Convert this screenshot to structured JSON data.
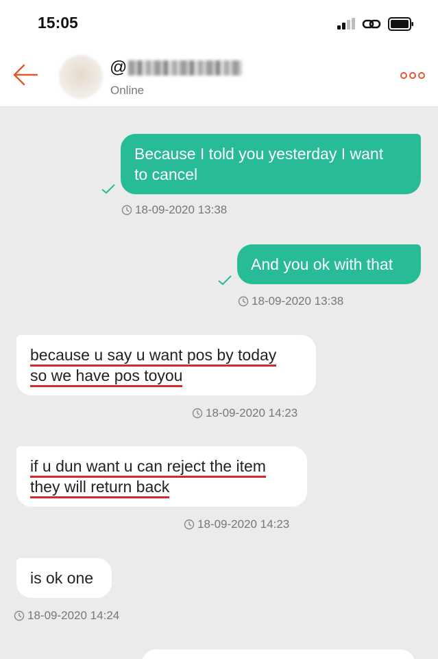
{
  "status_bar": {
    "time": "15:05"
  },
  "header": {
    "handle_prefix": "@",
    "status": "Online"
  },
  "colors": {
    "accent": "#e4572e",
    "sent_bubble": "#27bb98",
    "underline": "#d22a2a"
  },
  "messages": [
    {
      "direction": "sent",
      "lines": [
        "Because I told you yesterday I want",
        "to cancel"
      ],
      "timestamp": "18-09-2020 13:38",
      "read": true
    },
    {
      "direction": "sent",
      "lines": [
        "And you ok with that"
      ],
      "timestamp": "18-09-2020 13:38",
      "read": true
    },
    {
      "direction": "received",
      "lines": [
        "because u say u want pos by today",
        "so we have pos toyou"
      ],
      "timestamp": "18-09-2020 14:23",
      "underlined": true
    },
    {
      "direction": "received",
      "lines": [
        "if u dun want u can reject the item",
        "they will return back"
      ],
      "timestamp": "18-09-2020 14:23",
      "underlined": true
    },
    {
      "direction": "received",
      "lines": [
        "is ok one"
      ],
      "timestamp": "18-09-2020 14:24",
      "underlined": false
    }
  ]
}
